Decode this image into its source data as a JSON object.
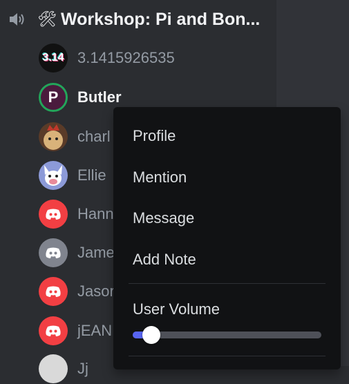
{
  "channel": {
    "title": "Workshop: Pi and Bon...",
    "icon": "speaker-icon",
    "emoji_icon": "tools-icon"
  },
  "members": [
    {
      "name": "3.1415926535",
      "avatar": "pi-avatar",
      "avatar_text": "3.14",
      "active": false
    },
    {
      "name": "Butler",
      "avatar": "butler-avatar",
      "avatar_text": "P",
      "active": true
    },
    {
      "name": "charl",
      "avatar": "photo-avatar",
      "active": false
    },
    {
      "name": "Ellie",
      "avatar": "dog-avatar",
      "active": false
    },
    {
      "name": "Hann",
      "avatar": "discord-red-avatar",
      "active": false
    },
    {
      "name": "Jame",
      "avatar": "discord-grey-avatar",
      "active": false
    },
    {
      "name": "Jasor",
      "avatar": "discord-red-avatar",
      "active": false
    },
    {
      "name": "jEAN",
      "avatar": "discord-red-avatar",
      "active": false
    },
    {
      "name": "Jj",
      "avatar": "photo-avatar",
      "active": false
    }
  ],
  "context_menu": {
    "items": [
      "Profile",
      "Mention",
      "Message",
      "Add Note"
    ],
    "volume_label": "User Volume",
    "volume_percent": 8
  },
  "colors": {
    "sidebar_bg": "#2b2d31",
    "menu_bg": "#111214",
    "accent": "#5865f2",
    "online": "#23a55a",
    "discord_red": "#f23f43"
  }
}
